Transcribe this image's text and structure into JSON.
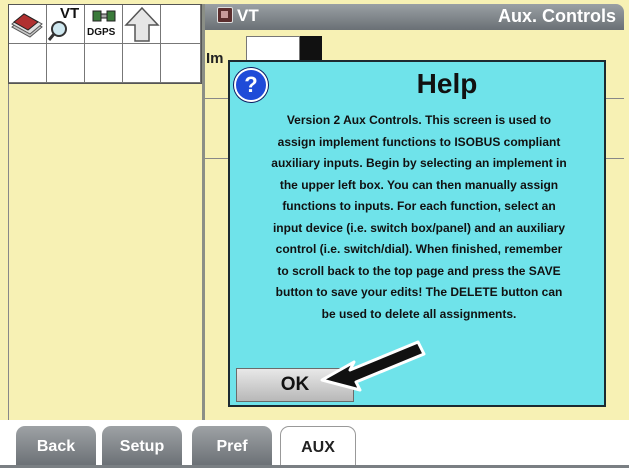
{
  "window": {
    "vt_label": "VT",
    "title": "Aux. Controls"
  },
  "toolbar_icons": {
    "gps_label": "DGPS",
    "vt_search_label": "VT",
    "icons": [
      "stack-icon",
      "vt-search-icon",
      "dgps-icon",
      "up-arrow-icon"
    ]
  },
  "form": {
    "implement_label": "Im"
  },
  "help_dialog": {
    "icon": "question-icon",
    "title": "Help",
    "body_lines": [
      "Version 2 Aux Controls.  This screen is used to",
      "assign implement functions to ISOBUS compliant",
      "auxiliary inputs. Begin by selecting an implement in",
      "the upper left box. You can then manually assign",
      "functions to inputs. For each function, select an",
      "input device (i.e. switch box/panel) and an auxiliary",
      "control (i.e. switch/dial). When finished, remember",
      "to scroll back to the top page and press the SAVE",
      "button to save your edits! The DELETE button can",
      "be used to delete all assignments."
    ],
    "ok_label": "OK"
  },
  "tabs": [
    {
      "label": "Back"
    },
    {
      "label": "Setup"
    },
    {
      "label": "Pref"
    },
    {
      "label": "AUX",
      "active": true
    }
  ],
  "colors": {
    "background": "#f7f1b4",
    "dialog": "#6fe3ea",
    "titlebar": "#7d8388",
    "help_icon": "#1f4bd8"
  }
}
